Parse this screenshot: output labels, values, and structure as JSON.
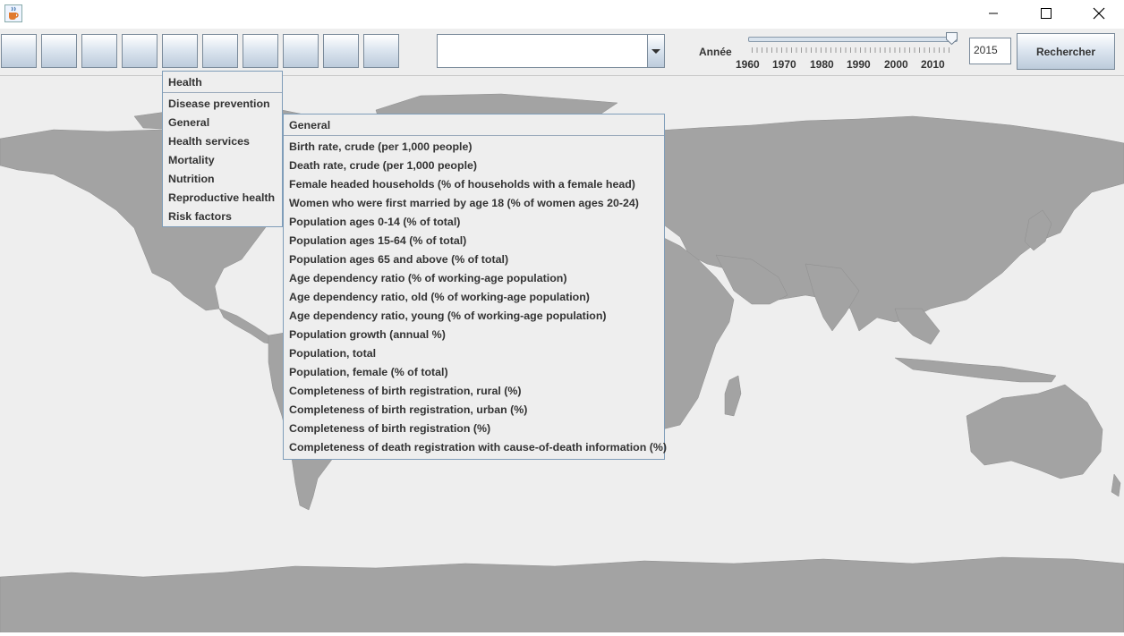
{
  "window": {
    "app_icon": "java-cup-icon",
    "controls": [
      "minimize-icon",
      "maximize-icon",
      "close-icon"
    ]
  },
  "toolbar": {
    "category_buttons_count": 10,
    "combo_value": "",
    "annee_label": "Année",
    "slider": {
      "min": 1960,
      "max": 2015,
      "value": 2015,
      "tick_labels": [
        "1960",
        "1970",
        "1980",
        "1990",
        "2000",
        "2010"
      ]
    },
    "year_value": "2015",
    "search_label": "Rechercher"
  },
  "health_menu": {
    "title": "Health",
    "items": [
      "Disease prevention",
      "General",
      "Health services",
      "Mortality",
      "Nutrition",
      "Reproductive health",
      "Risk factors"
    ]
  },
  "general_menu": {
    "title": "General",
    "items": [
      "Birth rate, crude (per 1,000 people)",
      "Death rate, crude (per 1,000 people)",
      "Female headed households (% of households with a female head)",
      "Women who were first married by age 18 (% of women ages 20-24)",
      "Population ages 0-14 (% of total)",
      "Population ages 15-64 (% of total)",
      "Population ages 65 and above (% of total)",
      "Age dependency ratio (% of working-age population)",
      "Age dependency ratio, old (% of working-age population)",
      "Age dependency ratio, young (% of working-age population)",
      "Population growth (annual %)",
      "Population, total",
      "Population, female (% of total)",
      "Completeness of birth registration, rural (%)",
      "Completeness of birth registration, urban (%)",
      "Completeness of birth registration (%)",
      "Completeness of death registration with cause-of-death information (%)"
    ]
  },
  "colors": {
    "map_land": "#a3a3a3",
    "map_background": "#eeeeee",
    "menu_border": "#7f9db9"
  }
}
